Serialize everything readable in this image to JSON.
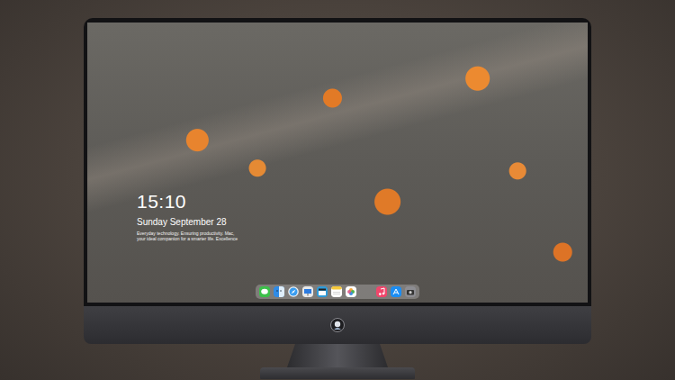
{
  "screen": {
    "clock": {
      "time": "15:10",
      "date": "Sunday September 28",
      "tagline": "Everyday technology. Ensuring productivity. Mac, your ideal companion for a smarter life. Excellence"
    }
  }
}
